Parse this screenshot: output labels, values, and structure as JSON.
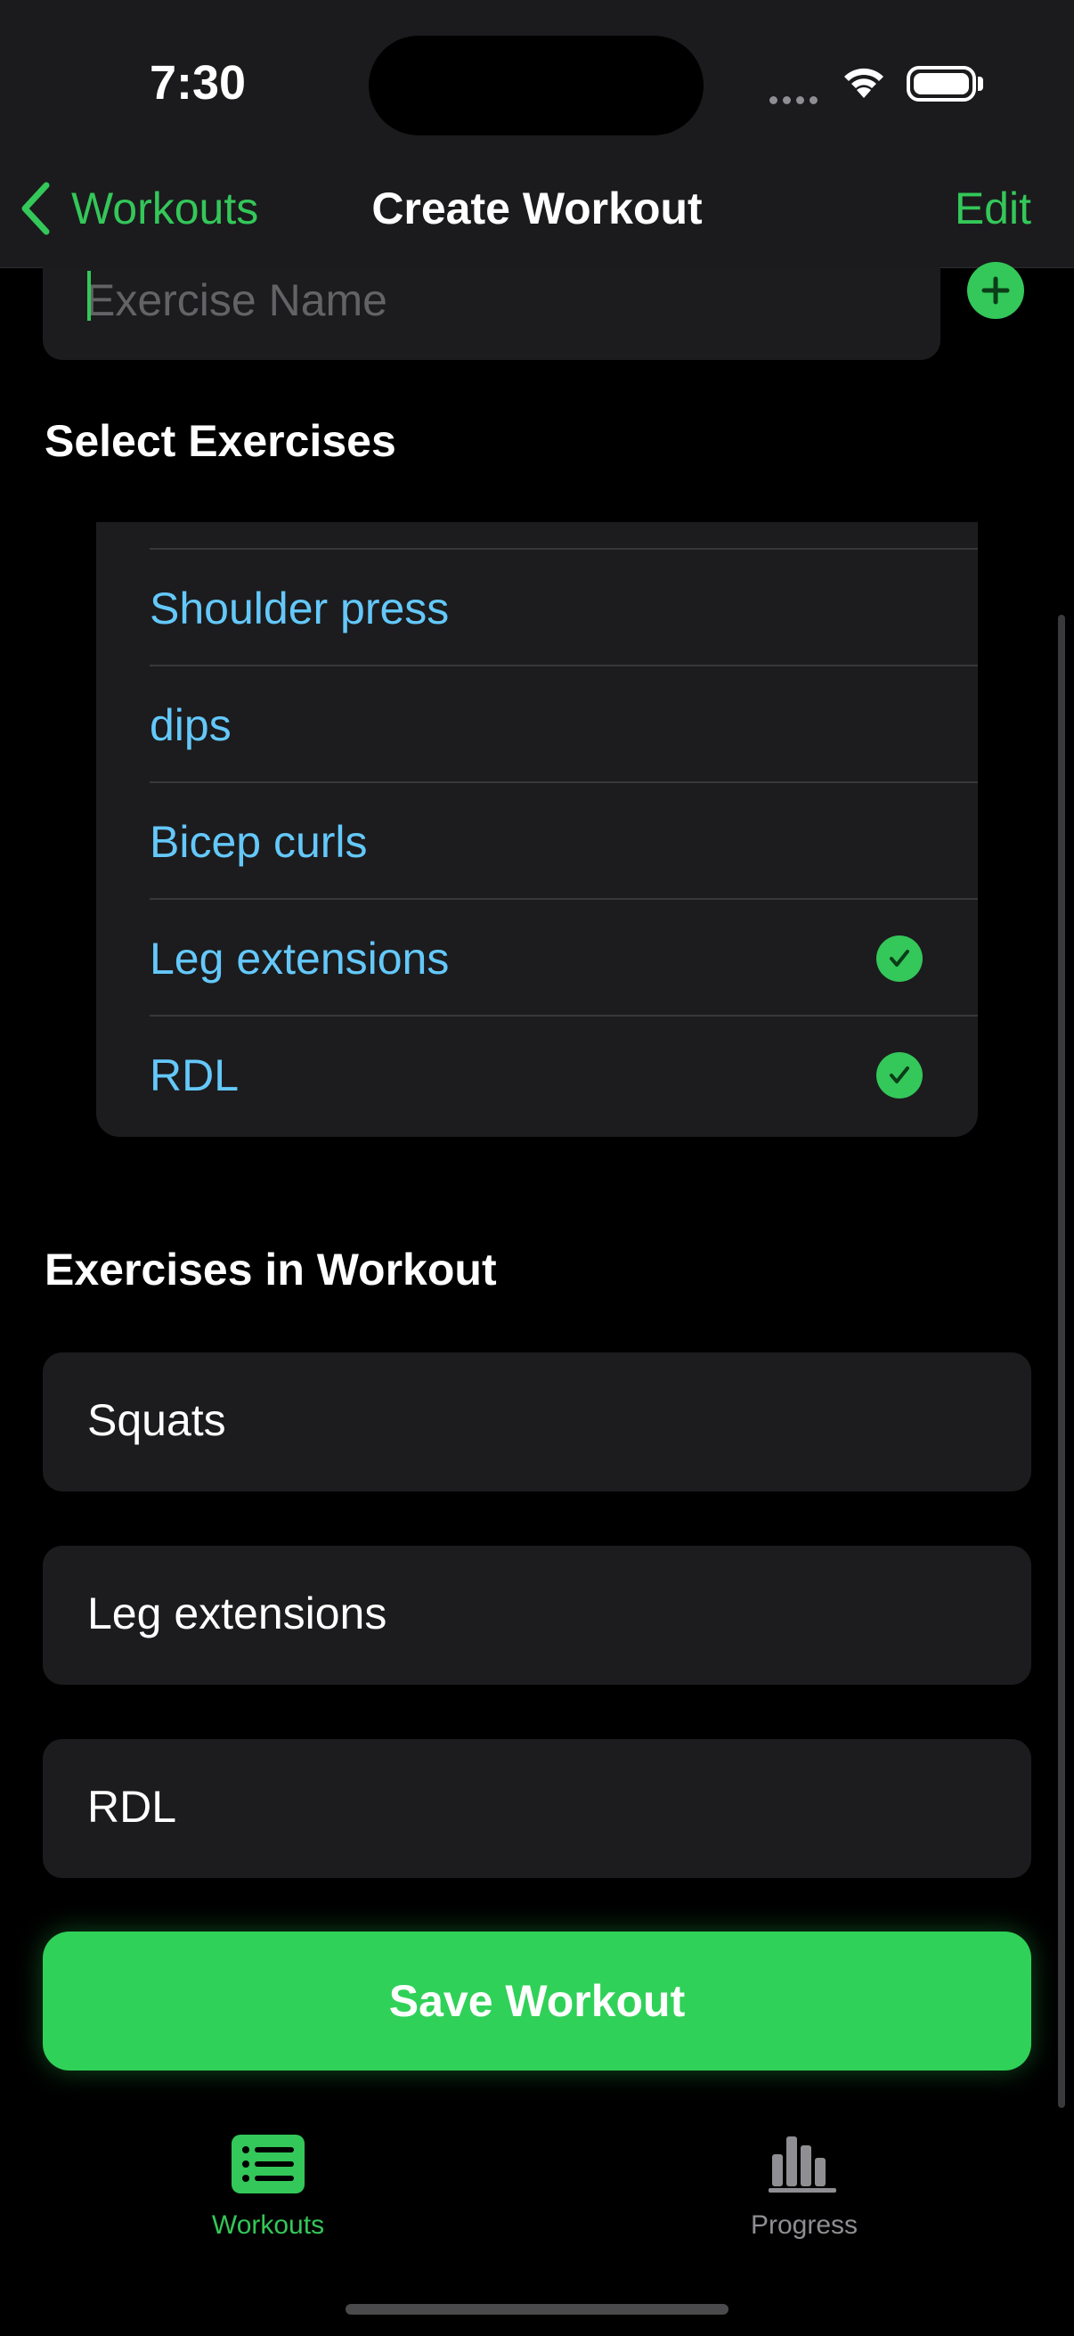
{
  "status_bar": {
    "time": "7:30"
  },
  "nav": {
    "back_label": "Workouts",
    "title": "Create Workout",
    "edit_label": "Edit"
  },
  "exercise_name": {
    "placeholder": "Exercise Name",
    "value": ""
  },
  "select_exercises": {
    "title": "Select Exercises",
    "items": [
      {
        "label": "Shoulder press",
        "selected": false
      },
      {
        "label": "dips",
        "selected": false
      },
      {
        "label": "Bicep curls",
        "selected": false
      },
      {
        "label": "Leg extensions",
        "selected": true
      },
      {
        "label": "RDL",
        "selected": true
      }
    ]
  },
  "workout_exercises": {
    "title": "Exercises in Workout",
    "items": [
      "Squats",
      "Leg extensions",
      "RDL"
    ]
  },
  "save_button": {
    "label": "Save Workout"
  },
  "tab_bar": {
    "tabs": [
      {
        "label": "Workouts",
        "icon": "list-icon",
        "active": true
      },
      {
        "label": "Progress",
        "icon": "bar-chart-icon",
        "active": false
      }
    ]
  },
  "colors": {
    "accent": "#34c759",
    "link": "#64c8fa",
    "background": "#000000",
    "card": "#1c1c1e"
  }
}
